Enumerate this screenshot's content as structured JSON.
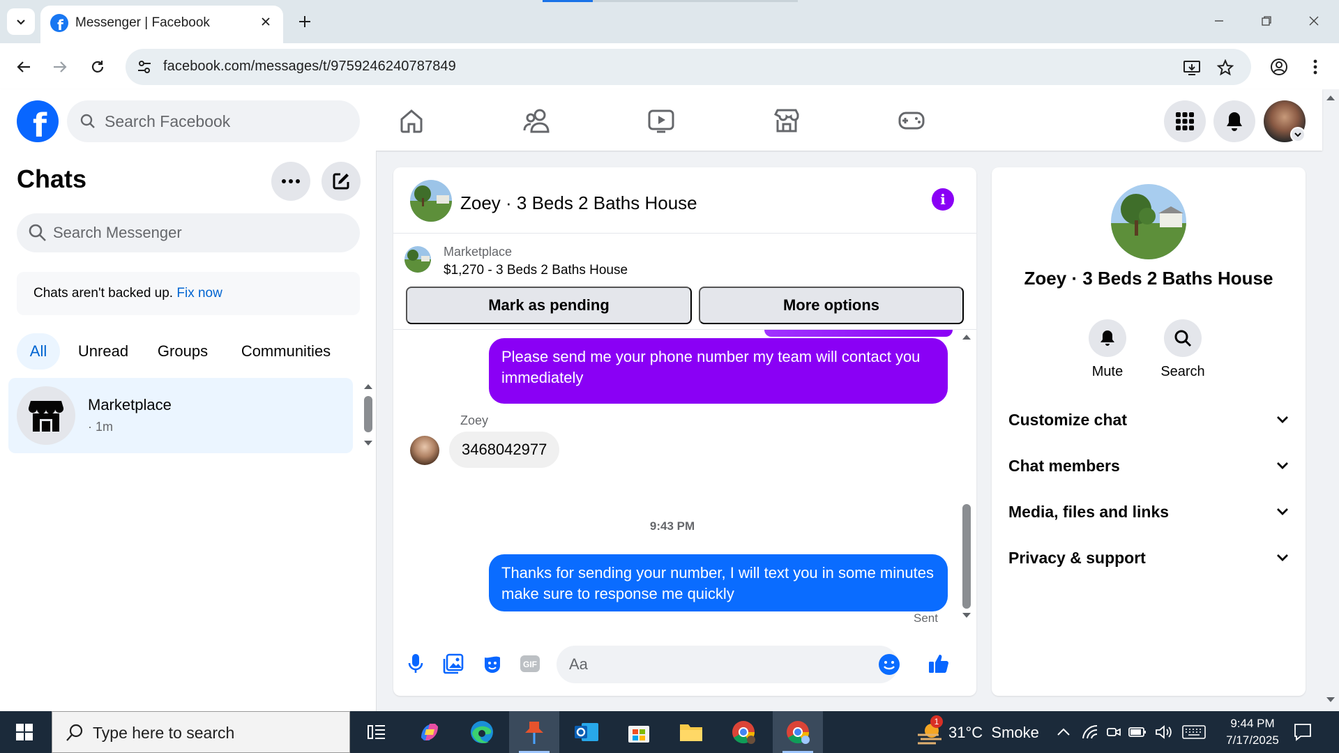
{
  "browser": {
    "tab_title": "Messenger | Facebook",
    "url": "facebook.com/messages/t/9759246240787849"
  },
  "facebook": {
    "search_placeholder": "Search Facebook"
  },
  "chats": {
    "title": "Chats",
    "search_placeholder": "Search Messenger",
    "backup_text": "Chats aren't backed up.",
    "backup_link": "Fix now",
    "filters": [
      "All",
      "Unread",
      "Groups",
      "Communities"
    ],
    "items": [
      {
        "name": "Marketplace",
        "time": "· 1m"
      }
    ]
  },
  "conversation": {
    "title": "Zoey · 3 Beds 2 Baths House",
    "marketplace_label": "Marketplace",
    "listing": "$1,270 - 3 Beds 2 Baths House",
    "btn_pending": "Mark as pending",
    "btn_more": "More options",
    "messages": [
      {
        "direction": "out",
        "text": "Please send me your phone number my team will contact you immediately"
      },
      {
        "direction": "in",
        "sender": "Zoey",
        "text": "3468042977"
      },
      {
        "direction": "out",
        "text": "Thanks for sending your number, I will text you in some minutes make sure to response me quickly"
      }
    ],
    "timestamp": "9:43 PM",
    "status": "Sent",
    "composer_placeholder": "Aa"
  },
  "info_panel": {
    "name": "Zoey · 3 Beds 2 Baths House",
    "actions": [
      "Mute",
      "Search"
    ],
    "sections": [
      "Customize chat",
      "Chat members",
      "Media, files and links",
      "Privacy & support"
    ]
  },
  "taskbar": {
    "search_placeholder": "Type here to search",
    "weather_temp": "31°C",
    "weather_desc": "Smoke",
    "weather_badge": "1",
    "time": "9:44 PM",
    "date": "7/17/2025"
  },
  "colors": {
    "fb_blue": "#0866ff",
    "purple_bubble": "#8a00f5",
    "blue_bubble": "#0a6cff",
    "link": "#0064d1"
  }
}
